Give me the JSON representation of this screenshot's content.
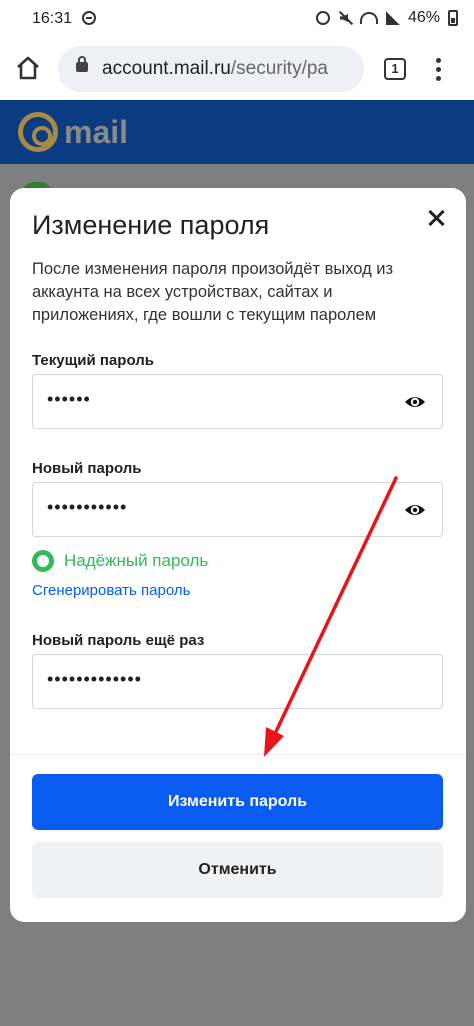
{
  "status_bar": {
    "time": "16:31",
    "battery": "46%",
    "icons": [
      "dnd-icon",
      "alarm-icon",
      "mute-icon",
      "wifi-icon",
      "signal-icon",
      "battery-icon"
    ]
  },
  "browser": {
    "url_domain": "account.mail.ru",
    "url_path": "/security/pa",
    "tab_count": "1"
  },
  "site": {
    "logo_text": "mail"
  },
  "dialog": {
    "title": "Изменение пароля",
    "description": "После изменения пароля произойдёт выход из аккаунта на всех устройствах, сайтах и приложениях, где вошли с текущим паролем",
    "current_password": {
      "label": "Текущий пароль",
      "value": "••••••"
    },
    "new_password": {
      "label": "Новый пароль",
      "value": "•••••••••••"
    },
    "strength": {
      "text": "Надёжный пароль",
      "color": "#34b95a"
    },
    "generate_link": "Сгенерировать пароль",
    "repeat_password": {
      "label": "Новый пароль ещё раз",
      "value": "•••••••••••••"
    },
    "submit_label": "Изменить пароль",
    "cancel_label": "Отменить"
  },
  "colors": {
    "primary": "#0a5cf0",
    "link": "#005ff9",
    "header": "#0b3b80",
    "annotation_arrow": "#e8141b"
  }
}
